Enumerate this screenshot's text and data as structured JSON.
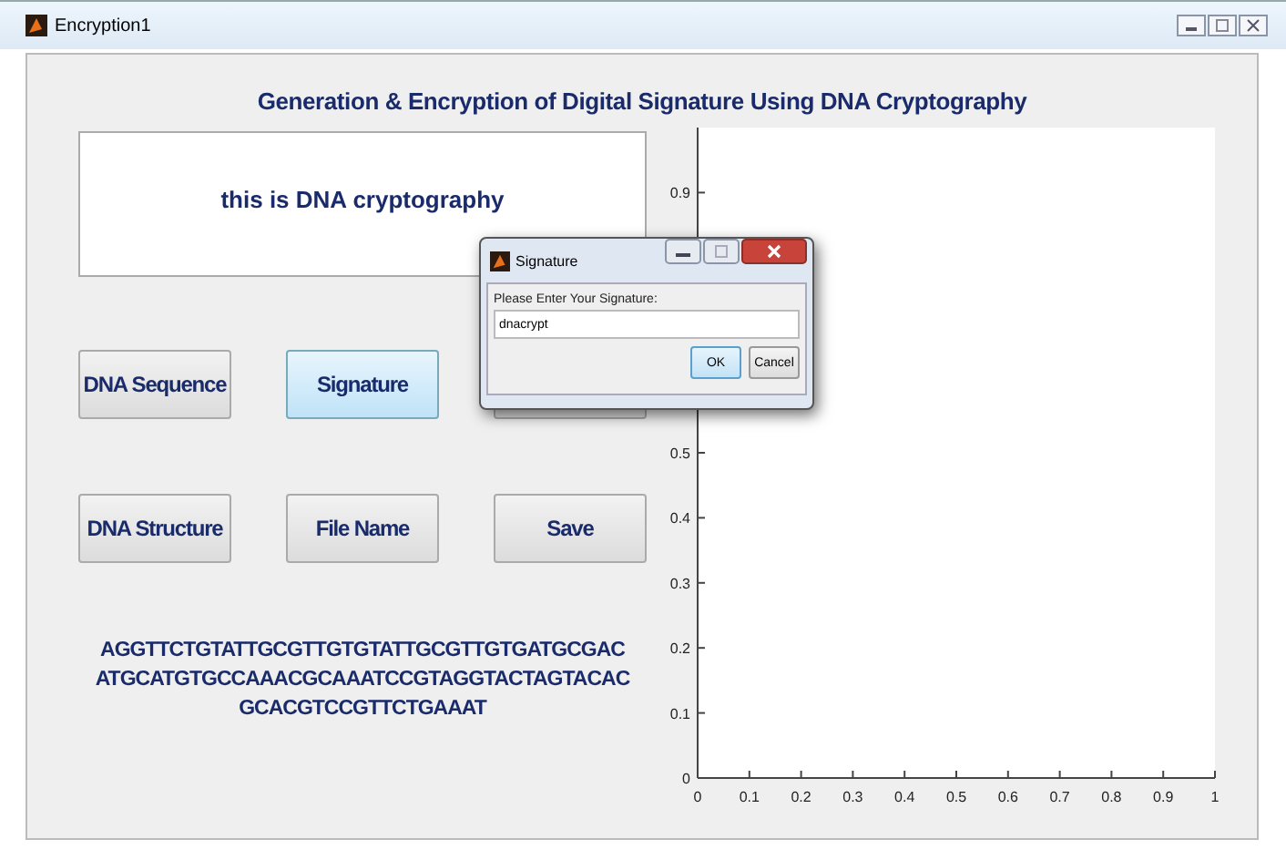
{
  "window": {
    "title": "Encryption1"
  },
  "heading": "Generation & Encryption of Digital Signature Using DNA Cryptography",
  "text_display": "this is DNA cryptography",
  "buttons": [
    {
      "kind": "push",
      "label": "DNA Sequence",
      "selected": false
    },
    {
      "kind": "push",
      "label": "Signature",
      "selected": true
    },
    {
      "kind": "covered"
    },
    {
      "kind": "push",
      "label": "DNA Structure",
      "selected": false
    },
    {
      "kind": "push",
      "label": "File Name",
      "selected": false
    },
    {
      "kind": "push",
      "label": "Save",
      "selected": false
    }
  ],
  "sequence_output": "AGGTTCTGTATTGCGTTGTGTATTGCGTTGTGATGCGAC ATGCATGTGCCAAACGCAAATCCGTAGGTACTAGTACAC GCACGTCCGTTCTGAAAT",
  "chart_data": {
    "type": "line",
    "xlim": [
      0,
      1
    ],
    "ylim": [
      0,
      1
    ],
    "xticks": [
      0,
      0.1,
      0.2,
      0.3,
      0.4,
      0.5,
      0.6,
      0.7,
      0.8,
      0.9,
      1
    ],
    "yticks": [
      0,
      0.1,
      0.2,
      0.3,
      0.4,
      0.5,
      0.9
    ]
  },
  "dialog": {
    "title": "Signature",
    "prompt": "Please Enter Your Signature:",
    "value": "dnacrypt",
    "buttons": [
      {
        "label": "OK",
        "selected": true
      },
      {
        "label": "Cancel",
        "selected": false
      }
    ]
  }
}
